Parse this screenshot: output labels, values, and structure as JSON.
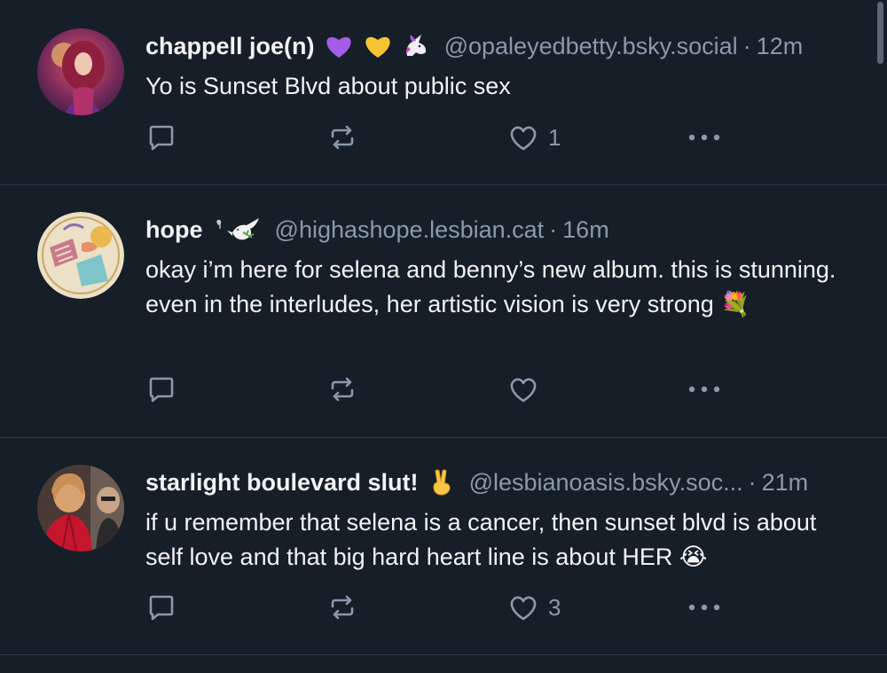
{
  "colors": {
    "background": "#161e27",
    "divider": "#2e3947",
    "muted_text": "#8a99ab",
    "primary_text": "#f1f3f5"
  },
  "posts": [
    {
      "display_name": "chappell joe(n)",
      "emojis": [
        "purple-heart",
        "yellow-heart",
        "unicorn"
      ],
      "handle": "@opaleyedbetty.bsky.social",
      "time": "12m",
      "text": "Yo is Sunset Blvd about public sex",
      "like_count": "1"
    },
    {
      "display_name": "hope",
      "emojis": [
        "dove-with-olive-branch"
      ],
      "handle": "@highashope.lesbian.cat",
      "time": "16m",
      "text": "okay i’m here for selena and benny’s new album. this is stunning. even in the interludes, her artistic vision is very strong 💐",
      "like_count": ""
    },
    {
      "display_name": "starlight boulevard slut!",
      "emojis": [
        "victory-hand"
      ],
      "handle": "@lesbianoasis.bsky.soc...",
      "time": "21m",
      "text": "if u remember that selena is a cancer, then sunset blvd is about self love and that big hard heart line is about HER 😭",
      "like_count": "3"
    }
  ],
  "separator": "·"
}
